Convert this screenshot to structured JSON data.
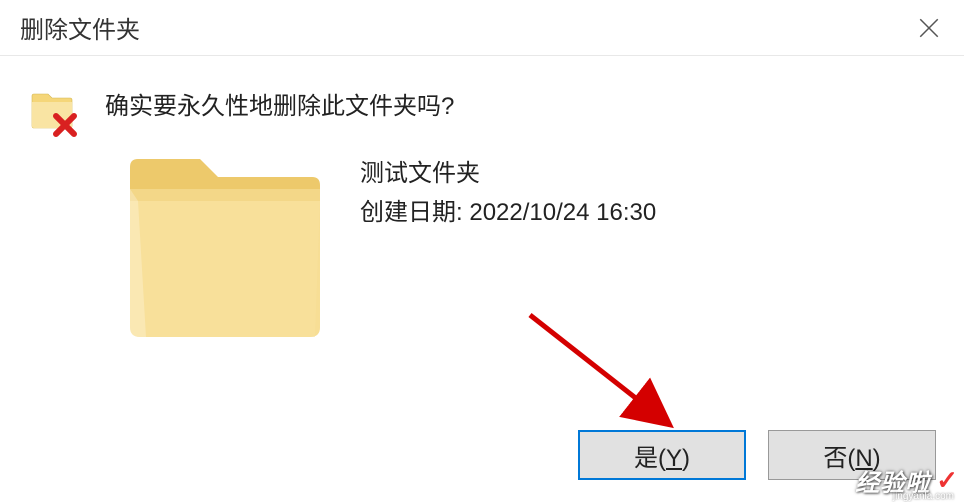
{
  "titlebar": {
    "title": "删除文件夹"
  },
  "dialog": {
    "question": "确实要永久性地删除此文件夹吗?",
    "item_name": "测试文件夹",
    "created_label": "创建日期:",
    "created_value": "2022/10/24 16:30"
  },
  "buttons": {
    "yes": "是(Y)",
    "no": "否(N)"
  },
  "icons": {
    "close": "close-icon",
    "folder_delete": "folder-delete-icon",
    "folder_large": "folder-icon"
  },
  "annotation": {
    "arrow_color": "#d40000"
  },
  "watermark": {
    "text": "经验啦",
    "url": "jingyanla.com"
  }
}
